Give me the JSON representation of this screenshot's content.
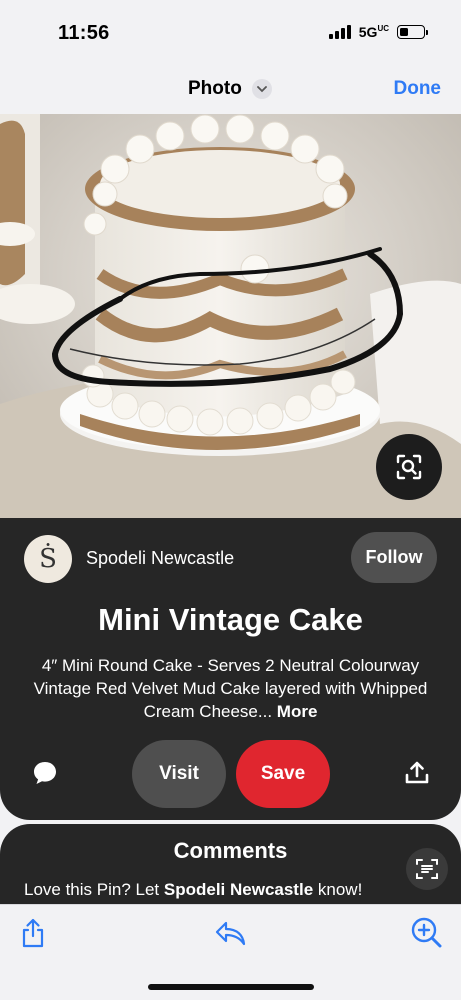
{
  "status_bar": {
    "time": "11:56",
    "network": "5G",
    "network_suffix": "UC",
    "battery_level": 0.35
  },
  "nav": {
    "title": "Photo",
    "done_label": "Done",
    "title_icon": "chevron-down-icon"
  },
  "photo": {
    "subject": "cake-photo",
    "lens_icon": "visual-search-icon"
  },
  "creator": {
    "initial": "Ṡ",
    "name": "Spodeli Newcastle",
    "follow_label": "Follow"
  },
  "pin": {
    "title": "Mini Vintage Cake",
    "description": "4″ Mini Round Cake - Serves 2 Neutral Colourway Vintage Red Velvet Mud Cake layered with Whipped Cream Cheese...",
    "more_label": "More",
    "visit_label": "Visit",
    "save_label": "Save"
  },
  "comments": {
    "title": "Comments",
    "prompt_prefix": "Love this Pin? Let ",
    "prompt_name": "Spodeli Newcastle",
    "prompt_suffix": " know!"
  },
  "toolbar": {
    "share_icon": "share-icon",
    "reply_icon": "reply-icon",
    "zoom_icon": "zoom-in-icon"
  },
  "colors": {
    "accent_blue": "#2f7bf5",
    "save_red": "#e0262f",
    "card_dark": "#262626"
  }
}
